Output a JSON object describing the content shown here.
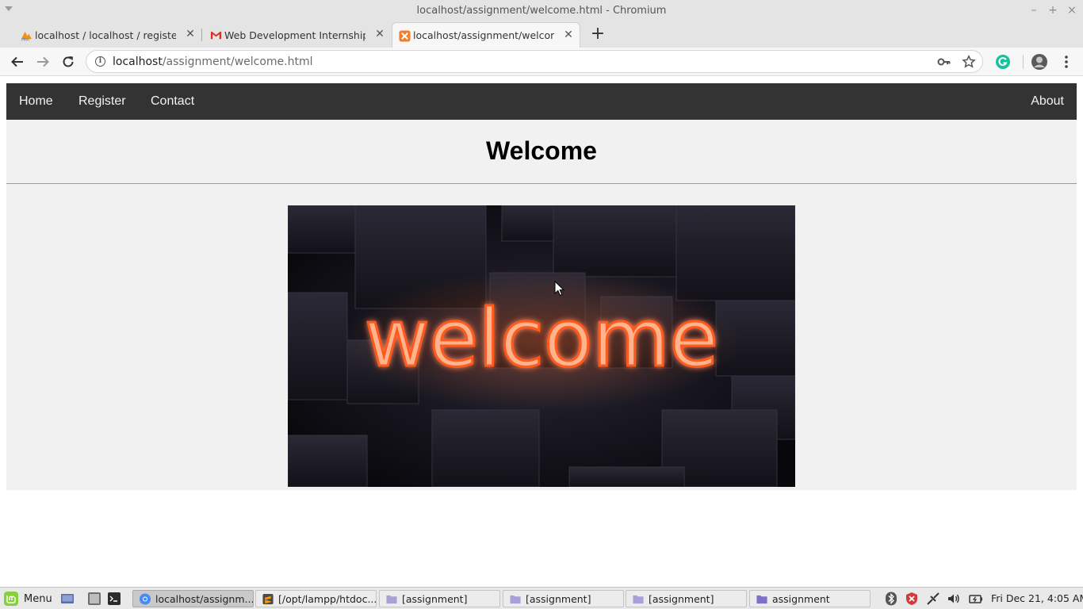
{
  "window": {
    "title": "localhost/assignment/welcome.html - Chromium",
    "minimize_label": "–",
    "maximize_label": "+",
    "close_label": "×"
  },
  "tabs": [
    {
      "title": "localhost / localhost / register / ",
      "icon": "phpmyadmin-icon",
      "active": false
    },
    {
      "title": "Web Development Internship fr",
      "icon": "gmail-icon",
      "active": false
    },
    {
      "title": "localhost/assignment/welcome",
      "icon": "xampp-icon",
      "active": true
    }
  ],
  "toolbar": {
    "url_host": "localhost",
    "url_path": "/assignment/welcome.html"
  },
  "site": {
    "nav_left": [
      "Home",
      "Register",
      "Contact"
    ],
    "nav_right": "About",
    "heading": "Welcome",
    "hero_text": "welcome"
  },
  "taskbar": {
    "menu_label": "Menu",
    "tasks": [
      {
        "label": "localhost/assignm...",
        "icon": "chromium-icon",
        "active": true
      },
      {
        "label": "[/opt/lampp/htdoc...",
        "icon": "sublime-text-icon",
        "active": false
      },
      {
        "label": "[assignment]",
        "icon": "folder-icon",
        "active": false
      },
      {
        "label": "[assignment]",
        "icon": "folder-icon",
        "active": false
      },
      {
        "label": "[assignment]",
        "icon": "folder-icon",
        "active": false
      },
      {
        "label": "assignment",
        "icon": "folder-icon",
        "active": false
      }
    ],
    "clock": "Fri Dec 21,  4:05 AM"
  },
  "colors": {
    "navbar_bg": "#333333",
    "content_bg": "#f1f1f1",
    "neon_glow": "#ff7a45"
  }
}
